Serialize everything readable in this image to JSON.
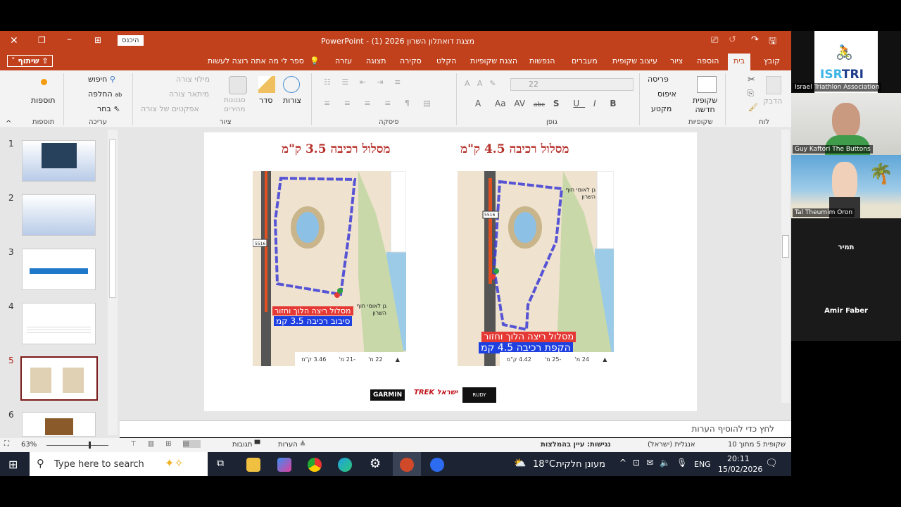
{
  "window": {
    "title": "מצגת דואתלון השרון 2026 (1)  -  PowerPoint",
    "signin": "היכנס"
  },
  "tabs": [
    "קובץ",
    "בית",
    "הוספה",
    "ציור",
    "עיצוב שקופית",
    "מעברים",
    "הנפשות",
    "הצגת שקופיות",
    "הקלט",
    "סקירה",
    "תצוגה",
    "עזרה"
  ],
  "tell_me": "ספר לי מה אתה רוצה לעשות",
  "share": "שיתוף",
  "ribbon": {
    "clipboard": {
      "paste": "הדבק",
      "group": "לוח"
    },
    "slides": {
      "new_slide": "שקופית",
      "new_slide2": "חדשה",
      "layout": "פריסה",
      "reset": "איפוס",
      "section": "מקטע",
      "group": "שקופיות"
    },
    "font": {
      "size": "22",
      "group": "גופן",
      "bold": "B",
      "italic": "I",
      "underline": "U",
      "shadow": "S",
      "strike": "abc",
      "spacing": "AV",
      "case": "Aa"
    },
    "paragraph": {
      "group": "פיסקה"
    },
    "drawing": {
      "shapes": "צורות",
      "arrange": "סדר",
      "quick_styles": "סגנונות",
      "quick_styles2": "מהירים",
      "fill": "מילוי צורה",
      "outline": "מיתאר צורה",
      "effects": "אפקטים של צורה",
      "group": "ציור"
    },
    "editing": {
      "find": "חיפוש",
      "replace": "החלפה",
      "select": "בחר",
      "group": "עריכה"
    },
    "addins": {
      "label": "תוספות",
      "group": "תוספות"
    }
  },
  "thumbnails": [
    {
      "n": "1"
    },
    {
      "n": "2"
    },
    {
      "n": "3"
    },
    {
      "n": "4"
    },
    {
      "n": "5",
      "selected": true
    },
    {
      "n": "6"
    }
  ],
  "slide": {
    "left_title": "מסלול רכיבה 3.5 ק\"מ",
    "right_title": "מסלול רכיבה 4.5 ק\"מ",
    "left_map": {
      "run_label": "מסלול ריצה הלוך וחזור",
      "bike_label": "סיבוב רכיבה 3.5 קמ",
      "park": "גן לאומי חוף השרון",
      "road": "5516",
      "stats": [
        "3.46 ק\"מ",
        "-21 מ'",
        "22 מ'"
      ]
    },
    "right_map": {
      "run_label": "מסלול ריצה הלוך וחזור",
      "bike_label": "הקפת רכיבה 4.5 קמ",
      "park": "גן לאומי חוף השרון",
      "road": "5516",
      "stats": [
        "4.42 ק\"מ",
        "-25 מ'",
        "24 מ'"
      ]
    },
    "sponsors": [
      "GARMIN",
      "TREK ישראל",
      "RUDY"
    ]
  },
  "notes_placeholder": "לחץ כדי להוסיף הערות",
  "status": {
    "slide_of": "שקופית 5 מתוך 10",
    "language": "אנגלית (ישראל)",
    "accessibility": "נגישות: עיין בהמלצות",
    "notes": "הערות",
    "comments": "תגובות",
    "zoom": "63%"
  },
  "taskbar": {
    "search": "Type here to search",
    "weather_temp": "18°C",
    "weather_text": "מעונן חלקית",
    "lang": "ENG",
    "time": "20:11",
    "date": "15/02/2026"
  },
  "zoom_panel": {
    "participants": [
      "Israel Triathlon Association",
      "Guy Kaftori The Buttons",
      "Tal Theumim Oron",
      "תמיר",
      "Amir Faber"
    ],
    "logo_text": "ISRTRI"
  },
  "colors": {
    "accent": "#c1411c",
    "slide_title": "#b5302a",
    "route": "#3b3bd6",
    "run_label": "#e53935",
    "bike_label": "#1e40e0"
  }
}
